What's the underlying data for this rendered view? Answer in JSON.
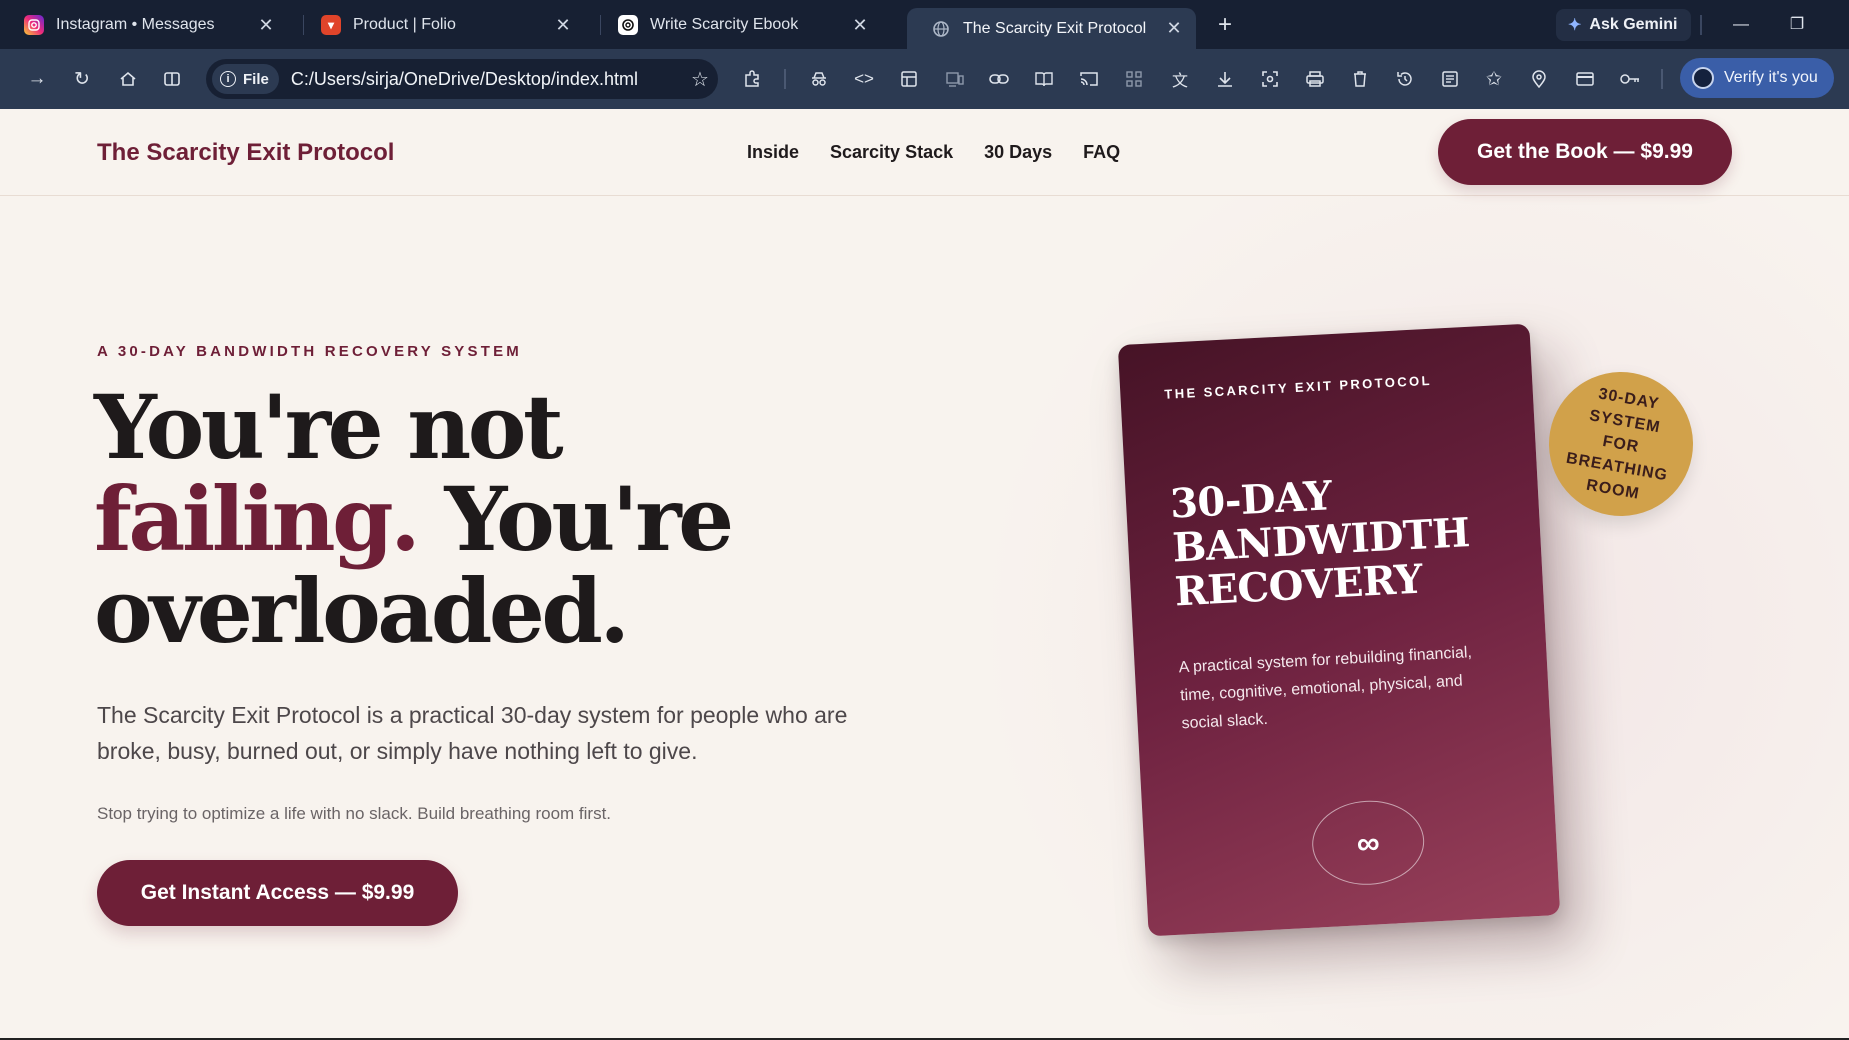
{
  "browser": {
    "tabs": [
      {
        "title": "Instagram • Messages",
        "icon": "instagram-icon",
        "color": "#d62976"
      },
      {
        "title": "Product | Folio",
        "icon": "folio-icon",
        "color": "#e0442a"
      },
      {
        "title": "Write Scarcity Ebook",
        "icon": "chatgpt-icon",
        "color": "#ffffff"
      },
      {
        "title": "The Scarcity Exit Protocol",
        "icon": "globe-icon",
        "color": "#9aa6b8",
        "active": true
      }
    ],
    "new_tab": "+",
    "gemini_label": "Ask Gemini",
    "address": {
      "chip": "File",
      "url": "C:/Users/sirja/OneDrive/Desktop/index.html"
    },
    "verify_label": "Verify it's you"
  },
  "site": {
    "brand": "The Scarcity Exit Protocol",
    "nav": [
      "Inside",
      "Scarcity Stack",
      "30 Days",
      "FAQ"
    ],
    "header_cta": "Get the Book — $9.99"
  },
  "hero": {
    "eyebrow": "A 30-DAY BANDWIDTH RECOVERY SYSTEM",
    "headline_1": "You're not",
    "headline_accent": "failing.",
    "headline_2": "You're",
    "headline_3": "overloaded.",
    "lead": "The Scarcity Exit Protocol is a practical 30-day system for people who are broke, busy, burned out, or simply have nothing left to give.",
    "sub": "Stop trying to optimize a life with no slack. Build breathing room first.",
    "cta": "Get Instant Access — $9.99"
  },
  "book": {
    "top_label": "THE SCARCITY EXIT PROTOCOL",
    "title": "30-DAY BANDWIDTH RECOVERY",
    "description": "A practical system for rebuilding financial, time, cognitive, emotional, physical, and social slack.",
    "emblem": "∞",
    "badge": "30-DAY SYSTEM FOR BREATHING ROOM"
  },
  "colors": {
    "accent": "#6e1f37",
    "badge": "#d1a14a",
    "chrome_dark": "#172033",
    "chrome_toolbar": "#2c3a52"
  }
}
